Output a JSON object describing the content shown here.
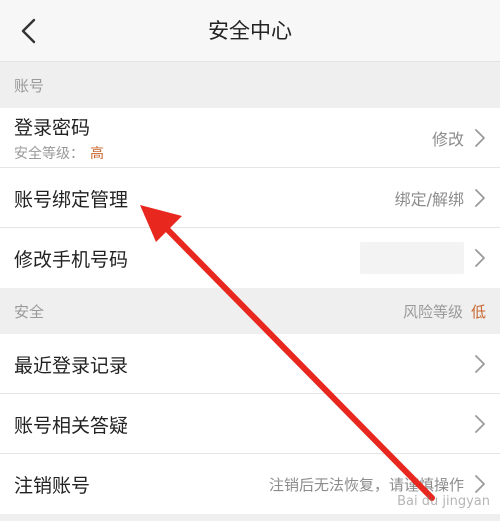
{
  "header": {
    "title": "安全中心"
  },
  "sections": [
    {
      "title": "账号",
      "rows": [
        {
          "label": "登录密码",
          "sub_prefix": "安全等级：",
          "sub_level": "高",
          "right": "修改"
        },
        {
          "label": "账号绑定管理",
          "right": "绑定/解绑"
        },
        {
          "label": "修改手机号码"
        }
      ]
    },
    {
      "title": "安全",
      "right_label": "风险等级",
      "right_level": "低",
      "rows": [
        {
          "label": "最近登录记录"
        },
        {
          "label": "账号相关答疑"
        },
        {
          "label": "注销账号",
          "right": "注销后无法恢复，请谨慎操作"
        }
      ]
    }
  ],
  "colors": {
    "accent_level": "#c8652d",
    "annotation_arrow": "#e8271f"
  },
  "watermark": "Bai du jingyan"
}
